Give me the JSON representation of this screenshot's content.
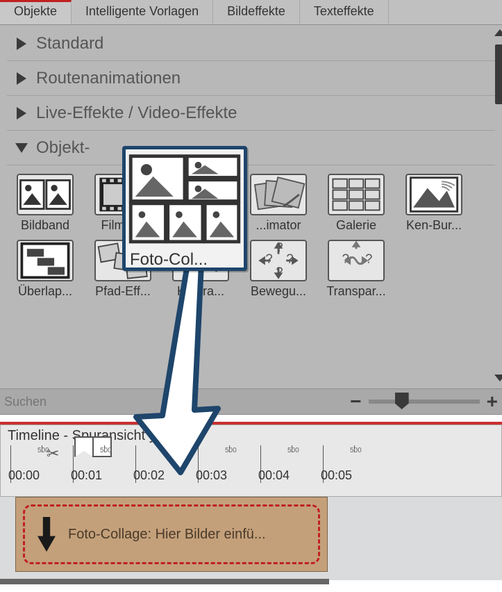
{
  "tabs": [
    "Objekte",
    "Intelligente Vorlagen",
    "Bildeffekte",
    "Texteffekte"
  ],
  "active_tab": 0,
  "categories": [
    {
      "label": "Standard",
      "open": false
    },
    {
      "label": "Routenanimationen",
      "open": false
    },
    {
      "label": "Live-Effekte / Video-Effekte",
      "open": false
    },
    {
      "label": "Objekt-",
      "open": true
    }
  ],
  "effects_row1": [
    {
      "label": "Bildband",
      "icon": "filmstrip"
    },
    {
      "label": "Filmst...",
      "icon": "filmstrip"
    },
    {
      "label": "",
      "icon": "collage"
    },
    {
      "label": "...imator",
      "icon": "flip"
    },
    {
      "label": "Galerie",
      "icon": "gallery"
    },
    {
      "label": "Ken-Bur...",
      "icon": "kenburns"
    }
  ],
  "effects_row2": [
    {
      "label": "Überlap...",
      "icon": "overlap"
    },
    {
      "label": "Pfad-Eff...",
      "icon": "path"
    },
    {
      "label": "K...era...",
      "icon": "camera"
    },
    {
      "label": "Bewegu...",
      "icon": "motion"
    },
    {
      "label": "Transpar...",
      "icon": "transp"
    }
  ],
  "search_placeholder": "Suchen",
  "timeline_title": "Timeline - Spuransicht          yboard",
  "ticks_small": "500",
  "ticks_big": [
    "00:00",
    "00:01",
    "00:02",
    "00:03",
    "00:04",
    "00:05"
  ],
  "clip_text": "Foto-Collage: Hier Bilder einfü...",
  "drag_label": "Foto-Col..."
}
